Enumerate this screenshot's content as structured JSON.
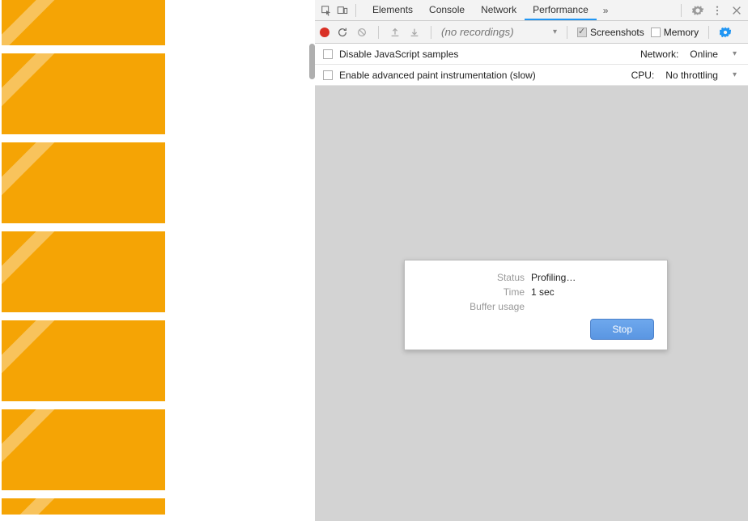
{
  "tabs": {
    "elements": "Elements",
    "console": "Console",
    "network": "Network",
    "performance": "Performance",
    "overflow": "»"
  },
  "toolbar": {
    "recordings_placeholder": "(no recordings)",
    "screenshots_label": "Screenshots",
    "memory_label": "Memory"
  },
  "options": {
    "disable_js_label": "Disable JavaScript samples",
    "enable_paint_label": "Enable advanced paint instrumentation (slow)",
    "network_label": "Network:",
    "network_value": "Online",
    "cpu_label": "CPU:",
    "cpu_value": "No throttling"
  },
  "dialog": {
    "status_label": "Status",
    "status_value": "Profiling…",
    "time_label": "Time",
    "time_value": "1 sec",
    "buffer_label": "Buffer usage",
    "stop_label": "Stop"
  }
}
